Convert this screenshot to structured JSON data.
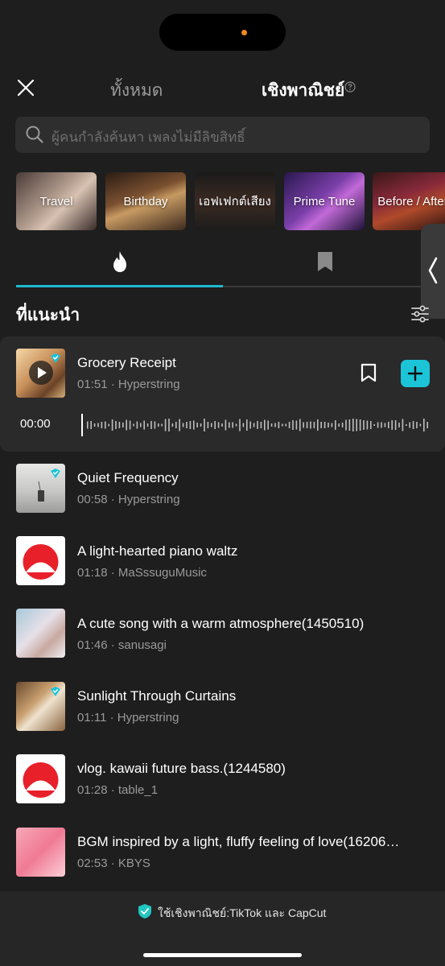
{
  "header": {
    "tab_all": "ทั้งหมด",
    "tab_commercial": "เชิงพาณิชย์",
    "close_icon": "close-icon",
    "help_icon": "help-circle-icon"
  },
  "search": {
    "placeholder": "ผู้คนกำลังค้นหา เพลงไม่มีลิขสิทธิ์"
  },
  "categories": [
    {
      "label": "Travel"
    },
    {
      "label": "Birthday"
    },
    {
      "label": "เอฟเฟกต์เสียง"
    },
    {
      "label": "Prime Tune"
    },
    {
      "label": "Before / After"
    }
  ],
  "segments": {
    "trending_icon": "fire-icon",
    "saved_icon": "bookmark-icon",
    "active": "trending"
  },
  "section": {
    "title": "ที่แนะนำ",
    "filter_icon": "filter-sliders-icon"
  },
  "player": {
    "time": "00:00",
    "progress": 0
  },
  "tracks": [
    {
      "title": "Grocery Receipt",
      "meta": "01:51 · Hyperstring"
    },
    {
      "title": "Quiet Frequency",
      "meta": "00:58 · Hyperstring"
    },
    {
      "title": "A light-hearted piano waltz",
      "meta": "01:18 · MaSssuguMusic"
    },
    {
      "title": "A cute song with a warm atmosphere(1450510)",
      "meta": "01:46 · sanusagi"
    },
    {
      "title": "Sunlight Through Curtains",
      "meta": "01:11 · Hyperstring"
    },
    {
      "title": "vlog. kawaii future bass.(1244580)",
      "meta": "01:28 · table_1"
    },
    {
      "title": "BGM inspired by a light, fluffy feeling of love(16206…",
      "meta": "02:53 · KBYS"
    }
  ],
  "footer": {
    "text": "ใช้เชิงพาณิชย์:TikTok และ CapCut",
    "icon": "shield-check-icon"
  },
  "colors": {
    "accent": "#1cc4d8",
    "background": "#1e1e1e"
  }
}
